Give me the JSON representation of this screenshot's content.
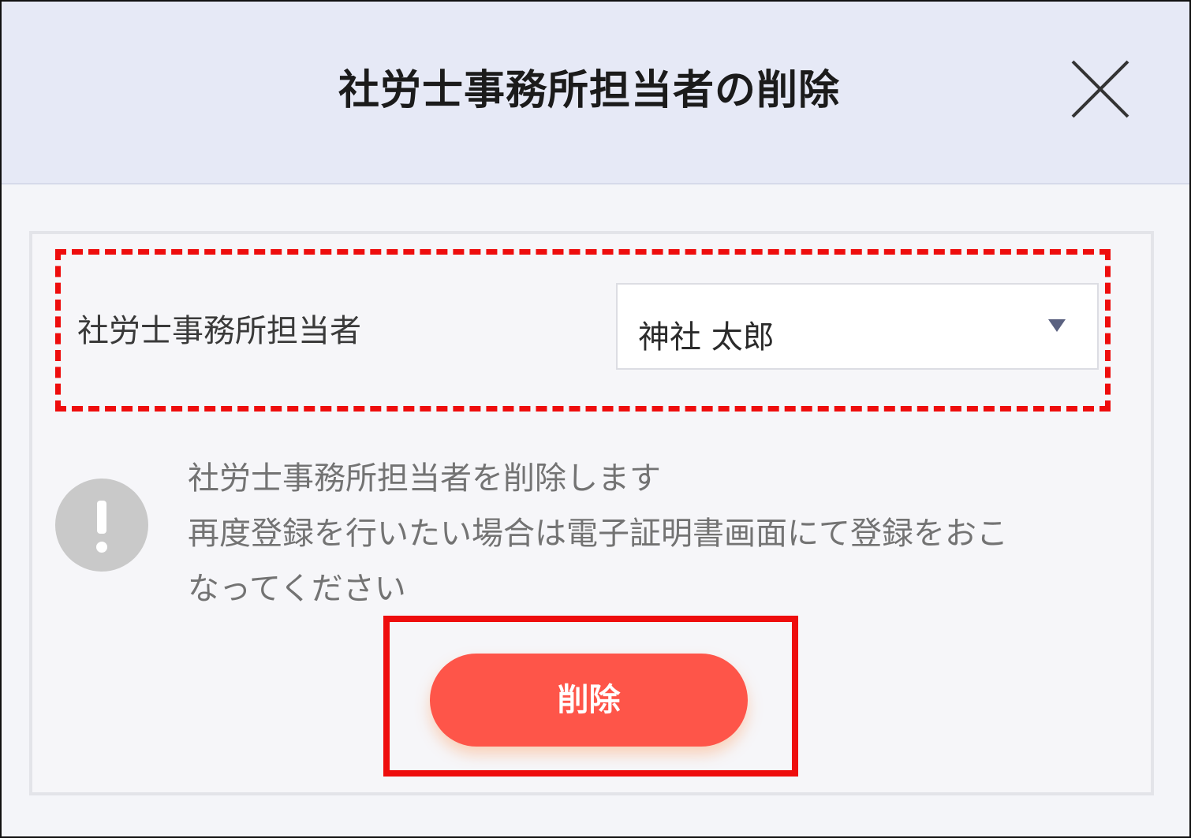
{
  "dialog": {
    "title": "社労士事務所担当者の削除",
    "close_icon": "close-icon"
  },
  "form": {
    "label": "社労士事務所担当者",
    "select_value": "神社 太郎",
    "select_arrow_icon": "caret-down-icon"
  },
  "message": {
    "icon": "exclamation-icon",
    "lines": [
      "社労士事務所担当者を削除します",
      "再度登録を行いたい場合は電子証明書画面にて登録をおこ",
      "なってください"
    ]
  },
  "actions": {
    "delete_label": "削除"
  },
  "colors": {
    "header_bg": "#e6e9f6",
    "annotation_red": "#ee0d0d",
    "delete_button": "#fe5549"
  }
}
